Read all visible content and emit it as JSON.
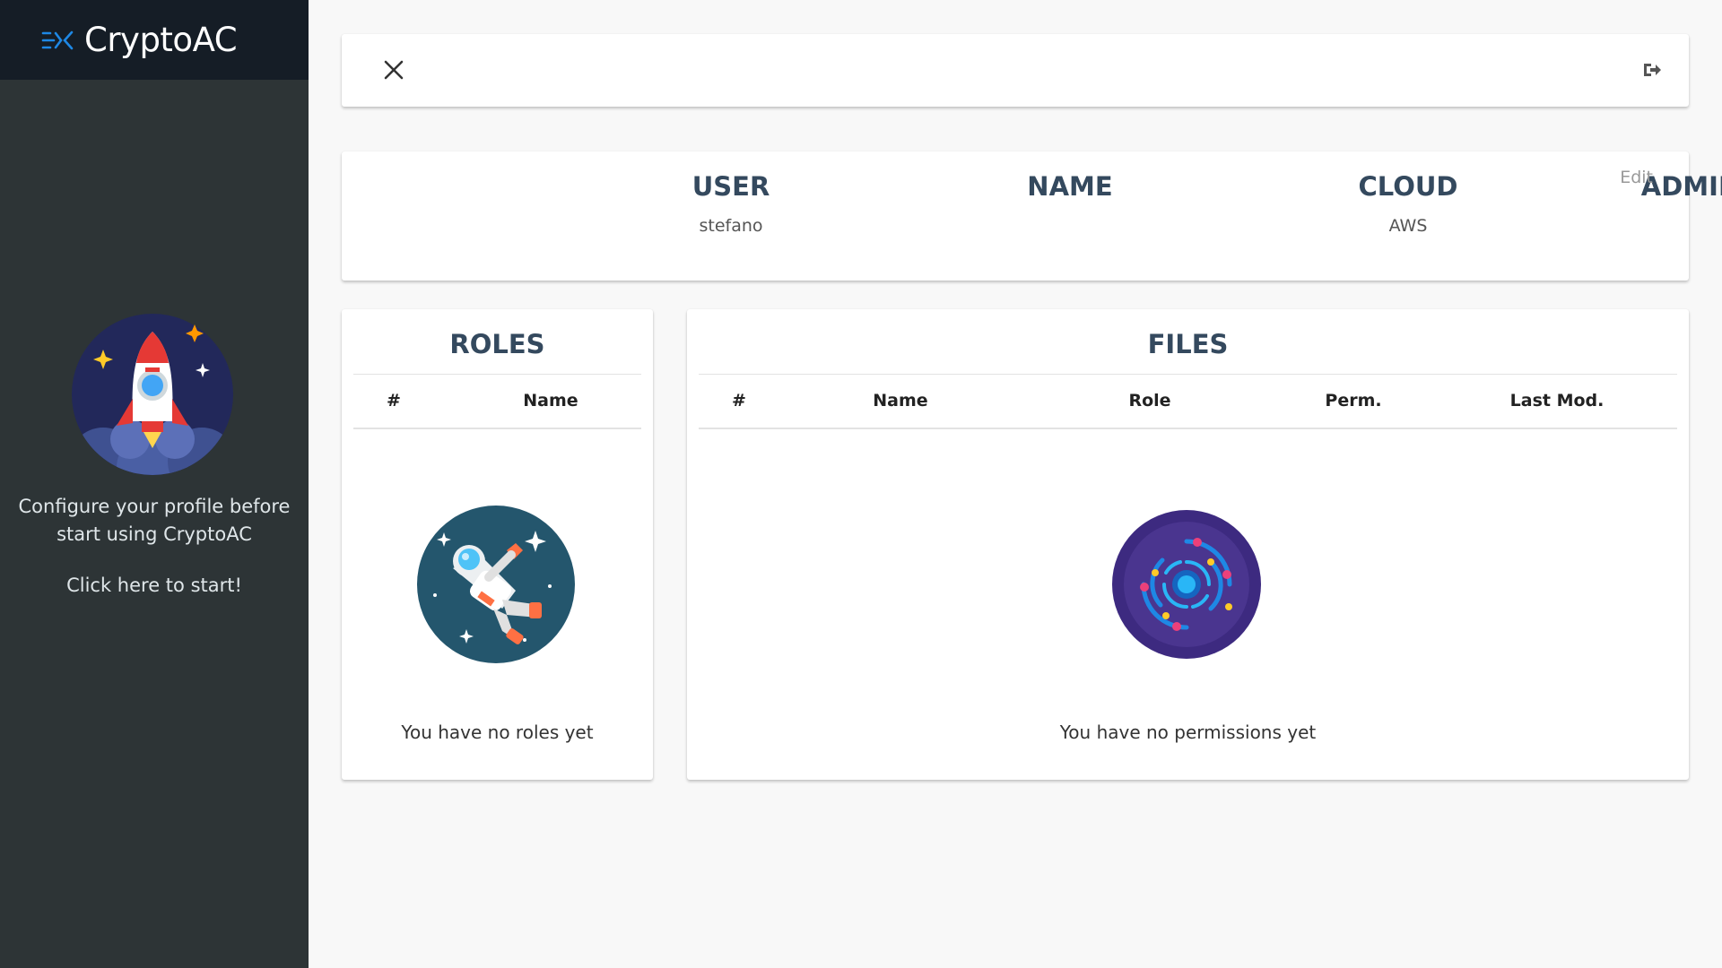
{
  "brand": {
    "name": "CryptoAC"
  },
  "sidebar": {
    "message": "Configure your profile before start using CryptoAC",
    "link": "Click here to start!"
  },
  "user_table": {
    "headers": {
      "user": "USER",
      "name": "NAME",
      "cloud": "CLOUD",
      "admin": "ADMIN"
    },
    "values": {
      "user": "stefano",
      "name": "",
      "cloud": "AWS",
      "admin": ""
    },
    "edit_label": "Edit"
  },
  "roles": {
    "title": "ROLES",
    "columns": [
      "#",
      "Name"
    ],
    "empty_message": "You have no roles yet"
  },
  "files": {
    "title": "FILES",
    "columns": [
      "#",
      "Name",
      "Role",
      "Perm.",
      "Last Mod."
    ],
    "empty_message": "You have no permissions yet"
  },
  "icons": {
    "brand_logo": "cryptoac-logo-icon",
    "close": "close-icon",
    "logout": "sign-out-icon",
    "rocket": "rocket-illustration",
    "astronaut": "astronaut-illustration",
    "galaxy": "galaxy-illustration"
  },
  "colors": {
    "sidebar": "#2d3436",
    "brand_bar": "#151d26",
    "heading": "#34495e",
    "background": "#f8f8f8"
  }
}
